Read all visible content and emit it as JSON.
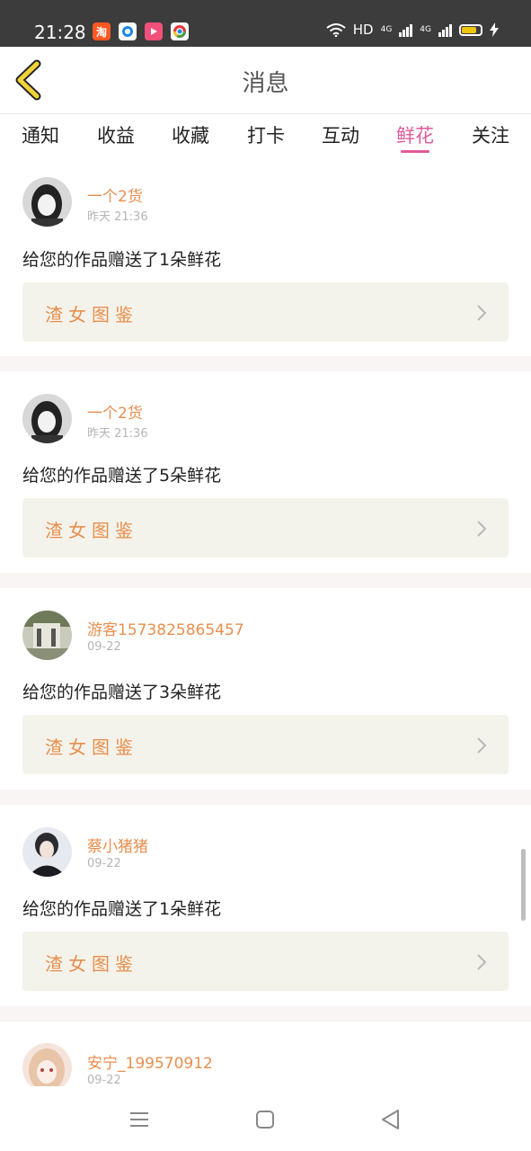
{
  "status_bar": {
    "time": "21:28",
    "network": "HD",
    "signal_label_1": "4G",
    "signal_label_2": "4G",
    "app_icons": [
      "taobao-icon",
      "app-icon-blue",
      "video-app-icon",
      "chrome-icon"
    ]
  },
  "header": {
    "title": "消息"
  },
  "tabs": [
    {
      "label": "通知"
    },
    {
      "label": "收益"
    },
    {
      "label": "收藏"
    },
    {
      "label": "打卡"
    },
    {
      "label": "互动"
    },
    {
      "label": "鲜花"
    },
    {
      "label": "关注"
    }
  ],
  "active_tab": "鲜花",
  "notifications": [
    {
      "user": "一个2货",
      "time": "昨天 21:36",
      "message": "给您的作品赠送了1朵鲜花",
      "work": "渣女图鉴"
    },
    {
      "user": "一个2货",
      "time": "昨天 21:36",
      "message": "给您的作品赠送了5朵鲜花",
      "work": "渣女图鉴"
    },
    {
      "user": "游客1573825865457",
      "time": "09-22",
      "message": "给您的作品赠送了3朵鲜花",
      "work": "渣女图鉴"
    },
    {
      "user": "蔡小猪猪",
      "time": "09-22",
      "message": "给您的作品赠送了1朵鲜花",
      "work": "渣女图鉴"
    },
    {
      "user": "安宁_199570912",
      "time": "09-22",
      "message": "",
      "work": ""
    }
  ],
  "colors": {
    "accent_pink": "#e05a9a",
    "username_orange": "#e88f4e",
    "work_bg": "#f4f3eb",
    "separator": "#f8f5f4"
  }
}
